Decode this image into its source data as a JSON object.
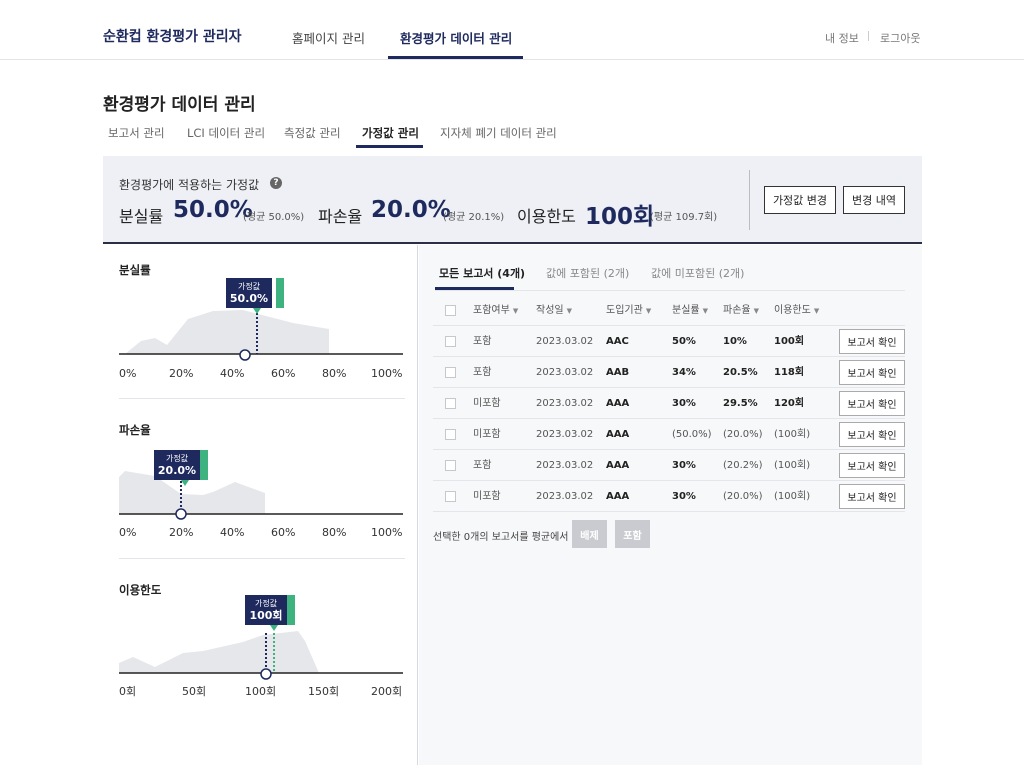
{
  "app": {
    "brand": "순환컵 환경평가 관리자"
  },
  "topnav": {
    "items": [
      "홈페이지 관리",
      "환경평가 데이터 관리"
    ],
    "active_index": 1
  },
  "util": {
    "my_info": "내 정보",
    "logout": "로그아웃"
  },
  "page": {
    "title": "환경평가 데이터 관리"
  },
  "subtabs": {
    "items": [
      "보고서 관리",
      "LCI 데이터 관리",
      "측정값 관리",
      "가정값 관리",
      "지자체 폐기 데이터 관리"
    ],
    "active_index": 3
  },
  "summary": {
    "label": "환경평가에 적용하는 가정값",
    "help_icon": "question-circle-icon",
    "metrics": [
      {
        "name": "분실률",
        "value": "50.0%",
        "avg": "(평균 50.0%)"
      },
      {
        "name": "파손율",
        "value": "20.0%",
        "avg": "(평균 20.1%)"
      },
      {
        "name": "이용한도",
        "value": "100회",
        "avg": "(평균 109.7회)"
      }
    ],
    "buttons": {
      "change": "가정값 변경",
      "history": "변경 내역"
    }
  },
  "charts": [
    {
      "title": "분실률",
      "marker_label": "가정값",
      "marker_value": "50.0%",
      "ticks": [
        "0%",
        "20%",
        "40%",
        "60%",
        "80%",
        "100%"
      ],
      "assumed": 50,
      "average": 50,
      "selected": 45,
      "axis_max": 100
    },
    {
      "title": "파손율",
      "marker_label": "가정값",
      "marker_value": "20.0%",
      "ticks": [
        "0%",
        "20%",
        "40%",
        "60%",
        "80%",
        "100%"
      ],
      "assumed": 20,
      "average": 20.1,
      "selected": 20,
      "axis_max": 100
    },
    {
      "title": "이용한도",
      "marker_label": "가정값",
      "marker_value": "100회",
      "ticks": [
        "0회",
        "50회",
        "100회",
        "150회",
        "200회"
      ],
      "assumed": 100,
      "average": 109.7,
      "selected": 100,
      "axis_max": 200
    }
  ],
  "report_tabs": {
    "items": [
      "모든 보고서 (4개)",
      "값에 포함된 (2개)",
      "값에 미포함된 (2개)"
    ],
    "active_index": 0
  },
  "table": {
    "headers": [
      "포함여부",
      "작성일",
      "도입기관",
      "분실률",
      "파손율",
      "이용한도"
    ],
    "action_label": "보고서 확인",
    "rows": [
      {
        "include": "포함",
        "date": "2023.03.02",
        "org": "AAC",
        "loss": "50%",
        "damage": "10%",
        "limit": "100회",
        "excluded": false
      },
      {
        "include": "포함",
        "date": "2023.03.02",
        "org": "AAB",
        "loss": "34%",
        "damage": "20.5%",
        "limit": "118회",
        "excluded": false
      },
      {
        "include": "미포함",
        "date": "2023.03.02",
        "org": "AAA",
        "loss": "30%",
        "damage": "29.5%",
        "limit": "120회",
        "excluded": false
      },
      {
        "include": "미포함",
        "date": "2023.03.02",
        "org": "AAA",
        "loss": "(50.0%)",
        "damage": "(20.0%)",
        "limit": "(100회)",
        "excluded": true
      },
      {
        "include": "포함",
        "date": "2023.03.02",
        "org": "AAA",
        "loss": "30%",
        "damage": "(20.2%)",
        "limit": "(100회)",
        "excluded": true
      },
      {
        "include": "미포함",
        "date": "2023.03.02",
        "org": "AAA",
        "loss": "30%",
        "damage": "(20.0%)",
        "limit": "(100회)",
        "excluded": true
      }
    ]
  },
  "footer": {
    "text": "선택한 0개의 보고서를 평균에서",
    "exclude": "배제",
    "include": "포함"
  },
  "colors": {
    "navy": "#1e2a5e",
    "green": "#3fb37f",
    "area": "#e6e7eb"
  }
}
